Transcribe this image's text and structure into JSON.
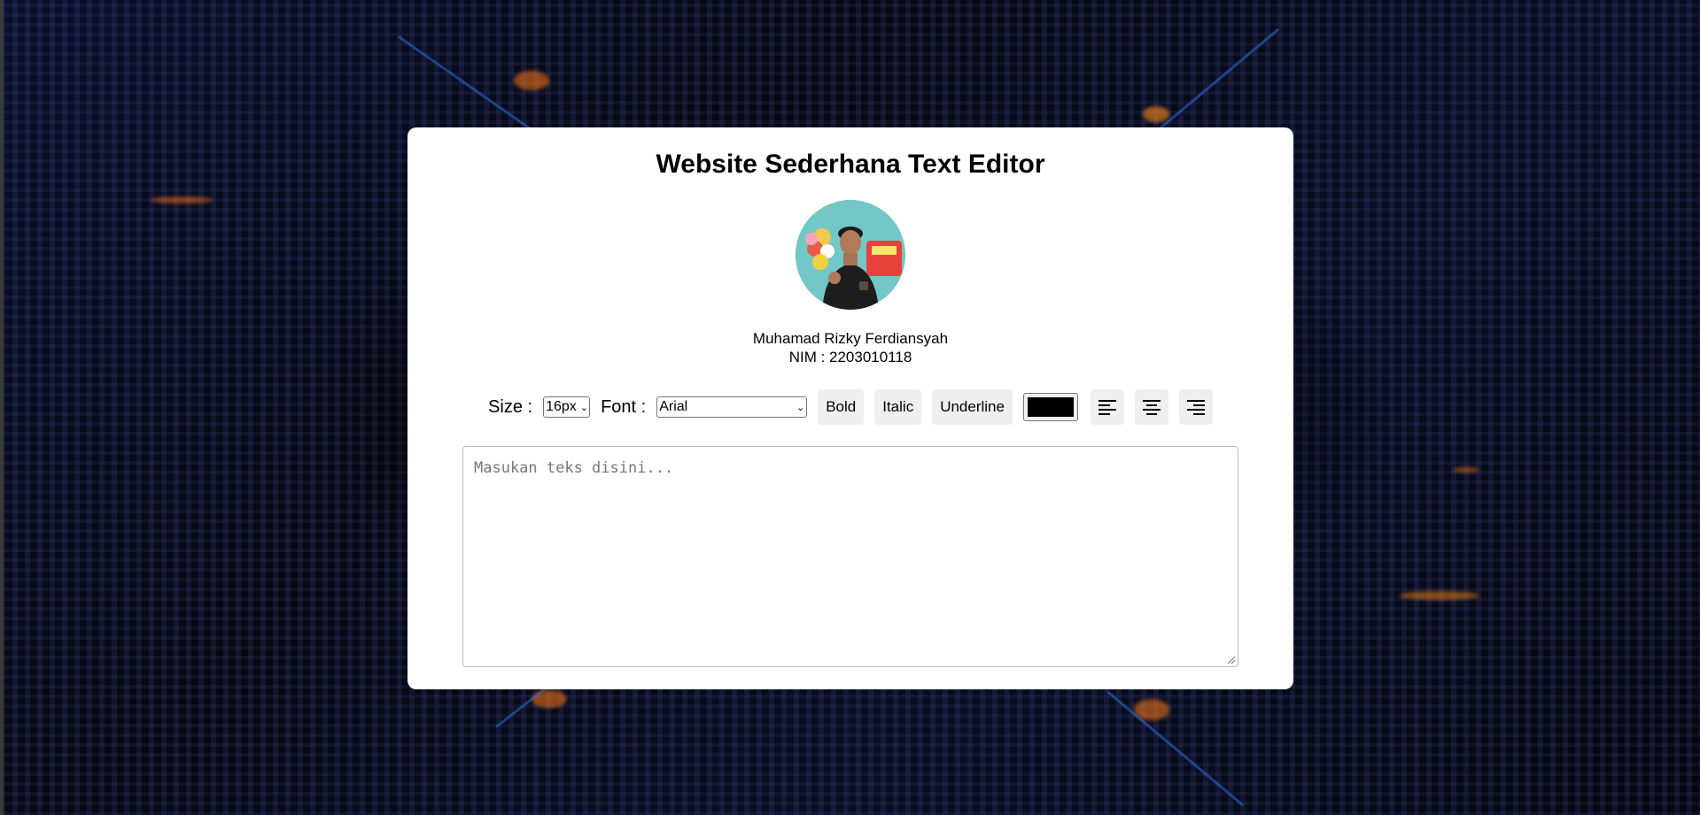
{
  "app": {
    "title": "Website Sederhana Text Editor"
  },
  "profile": {
    "name": "Muhamad Rizky Ferdiansyah",
    "nim": "NIM : 2203010118"
  },
  "toolbar": {
    "size_label": "Size :",
    "size_value": "16px",
    "font_label": "Font :",
    "font_value": "Arial",
    "bold_label": "Bold",
    "italic_label": "Italic",
    "underline_label": "Underline",
    "text_color": "#000000",
    "align_icons": [
      "align-left-icon",
      "align-center-icon",
      "align-right-icon"
    ]
  },
  "editor": {
    "placeholder": "Masukan teks disini..."
  },
  "colors": {
    "card_bg": "#ffffff",
    "button_bg": "#efefef",
    "page_bg": "#05060d"
  }
}
